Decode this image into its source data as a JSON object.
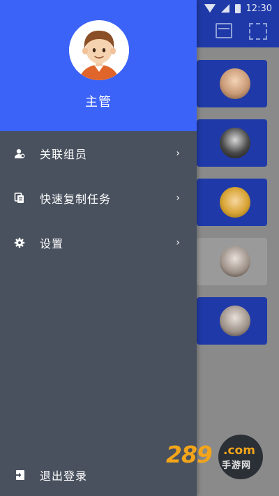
{
  "status_bar": {
    "time": "12:30"
  },
  "drawer": {
    "user_name": "主管",
    "menu": [
      {
        "label": "关联组员",
        "icon": "user-link-icon"
      },
      {
        "label": "快速复制任务",
        "icon": "copy-icon"
      },
      {
        "label": "设置",
        "icon": "gear-icon"
      }
    ],
    "chevron": "›",
    "logout_label": "退出登录"
  },
  "watermark": {
    "number": "289",
    "domain": ".com",
    "subtitle": "手游网"
  },
  "colors": {
    "drawer_header": "#3b63f7",
    "drawer_body": "#49515e",
    "app_header": "#1f3aa8",
    "watermark": "#f2a51a"
  }
}
